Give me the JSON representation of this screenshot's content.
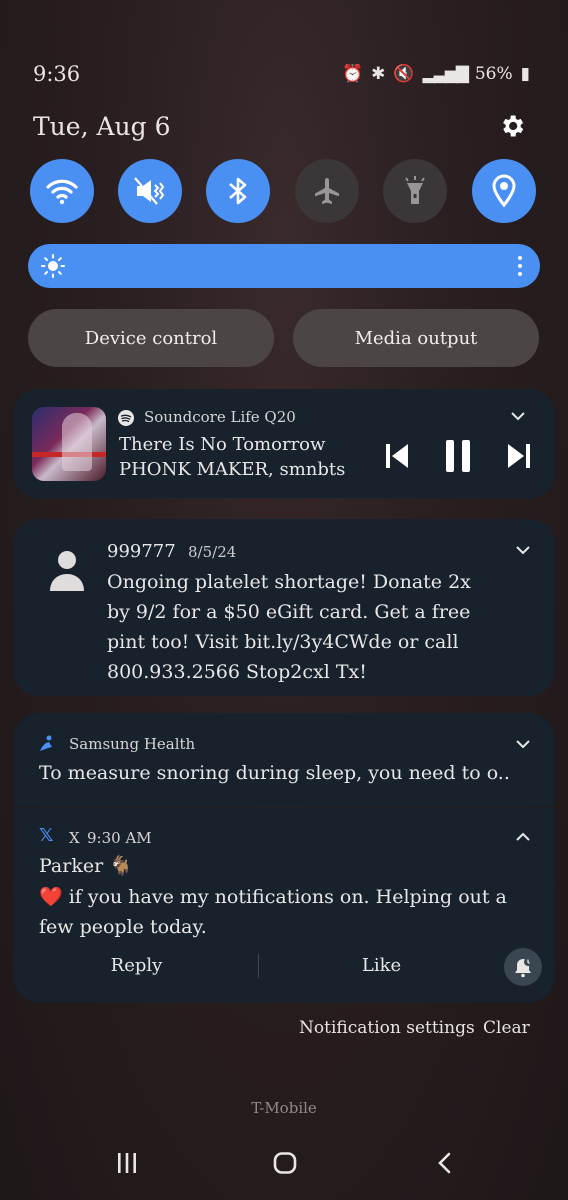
{
  "status": {
    "time": "9:36",
    "battery": "56%"
  },
  "date": "Tue, Aug 6",
  "quick_tiles": [
    {
      "name": "wifi",
      "on": true
    },
    {
      "name": "mute",
      "on": true
    },
    {
      "name": "bluetooth",
      "on": true
    },
    {
      "name": "airplane",
      "on": false
    },
    {
      "name": "flashlight",
      "on": false
    },
    {
      "name": "location",
      "on": true
    }
  ],
  "buttons": {
    "device_control": "Device control",
    "media_output": "Media output"
  },
  "media": {
    "app": "Soundcore Life Q20",
    "title": "There Is No Tomorrow",
    "artist": "PHONK MAKER, smnbts"
  },
  "sms": {
    "sender": "999777",
    "date": "8/5/24",
    "body_lines": [
      "Ongoing platelet shortage! Donate 2x",
      "by 9/2 for a $50 eGift card. Get a free",
      "pint too! Visit bit.ly/3y4CWde or call",
      "800.933.2566 Stop2cxl Tx!"
    ]
  },
  "health": {
    "app": "Samsung Health",
    "body": "To measure snoring during sleep, you need to o.."
  },
  "x_notif": {
    "app": "X",
    "time": "9:30 AM",
    "sender": "Parker 🐐",
    "body_line1": "❤️ if you have my notifications on. Helping out  a",
    "body_line2": "few people today.",
    "reply": "Reply",
    "like": "Like"
  },
  "footer": {
    "settings": "Notification settings",
    "clear": "Clear",
    "carrier": "T-Mobile"
  },
  "colors": {
    "accent": "#4a8ff2",
    "card": "#18222c"
  }
}
